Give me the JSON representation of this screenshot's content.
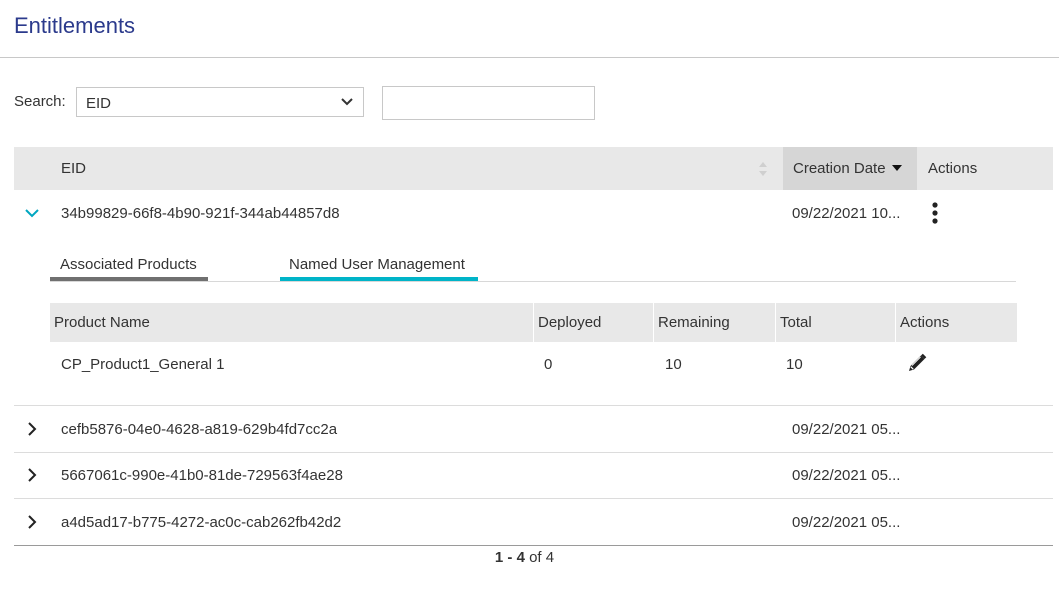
{
  "page": {
    "title": "Entitlements"
  },
  "search": {
    "label": "Search:",
    "field": "EID",
    "value": ""
  },
  "table": {
    "columns": {
      "eid": "EID",
      "creation_date": "Creation Date",
      "actions": "Actions"
    },
    "rows": [
      {
        "eid": "34b99829-66f8-4b90-921f-344ab44857d8",
        "date": "09/22/2021 10...",
        "expanded": true
      },
      {
        "eid": "cefb5876-04e0-4628-a819-629b4fd7cc2a",
        "date": "09/22/2021 05...",
        "expanded": false
      },
      {
        "eid": "5667061c-990e-41b0-81de-729563f4ae28",
        "date": "09/22/2021 05...",
        "expanded": false
      },
      {
        "eid": "a4d5ad17-b775-4272-ac0c-cab262fb42d2",
        "date": "09/22/2021 05...",
        "expanded": false
      }
    ]
  },
  "detail": {
    "tabs": [
      "Associated Products",
      "Named User Management"
    ],
    "columns": [
      "Product Name",
      "Deployed",
      "Remaining",
      "Total",
      "Actions"
    ],
    "rows": [
      {
        "product": "CP_Product1_General 1",
        "deployed": "0",
        "remaining": "10",
        "total": "10"
      }
    ]
  },
  "pagination": {
    "range": "1 - 4",
    "of_label": "of",
    "total": "4"
  },
  "colors": {
    "title": "#2b3a8c",
    "accent": "#00b4c8",
    "header_bg": "#e8e8e8"
  },
  "icons": [
    "chevron-down-icon",
    "sort-icon",
    "sort-desc-icon",
    "kebab-menu-icon",
    "pencil-icon",
    "chevron-right-icon"
  ]
}
